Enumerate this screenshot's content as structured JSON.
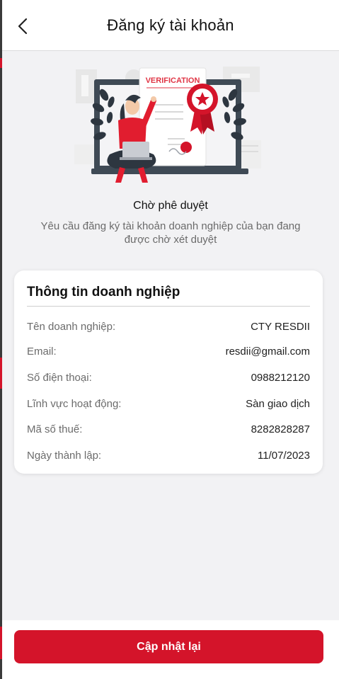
{
  "header": {
    "title": "Đăng ký tài khoản",
    "back_icon": "chevron-left-icon"
  },
  "illustration": {
    "badge_text": "VERIFICATION"
  },
  "status": {
    "title": "Chờ phê duyệt",
    "description": "Yêu cầu đăng ký tài khoản doanh nghiệp của bạn đang được chờ xét duyệt"
  },
  "info_card": {
    "title": "Thông tin doanh nghiệp",
    "rows": [
      {
        "label": "Tên doanh nghiệp:",
        "value": "CTY RESDII"
      },
      {
        "label": "Email:",
        "value": "resdii@gmail.com"
      },
      {
        "label": "Số điện thoại:",
        "value": "0988212120"
      },
      {
        "label": "Lĩnh vực hoạt động:",
        "value": "Sàn giao dịch"
      },
      {
        "label": "Mã số thuế:",
        "value": "8282828287"
      },
      {
        "label": "Ngày thành lập:",
        "value": "11/07/2023"
      }
    ]
  },
  "footer": {
    "button_label": "Cập nhật lại"
  },
  "colors": {
    "accent": "#d4142a",
    "background": "#f2f2f4"
  }
}
